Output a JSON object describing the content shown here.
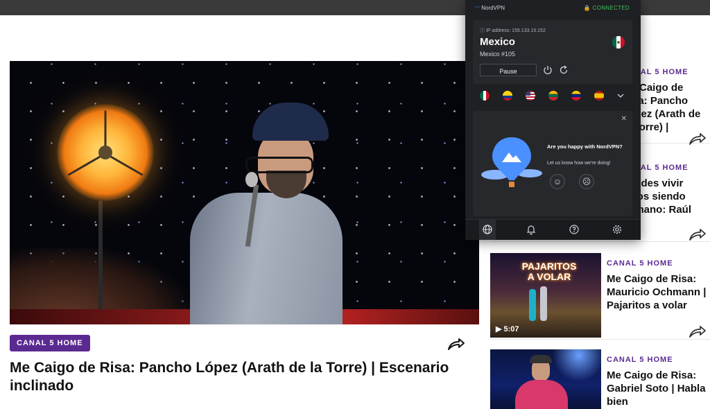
{
  "main": {
    "category": "CANAL 5 HOME",
    "title": "Me Caigo de Risa: Pancho López (Arath de la Torre) | Escenario inclinado"
  },
  "sidebar": {
    "items": [
      {
        "category": "CANAL 5 HOME",
        "title": "Me Caigo de Risa: Pancho López (Arath de la Torre) | Escenario..."
      },
      {
        "category": "CANAL 5 HOME",
        "title": "Puedes vivir tecos siendo humano: Raúl"
      },
      {
        "category": "CANAL 5 HOME",
        "title": "Me Caigo de Risa: Mauricio Ochmann | Pajaritos a volar",
        "duration": "5:07",
        "thumb_text": "PAJARITOS A VOLAR"
      },
      {
        "category": "CANAL 5 HOME",
        "title": "Me Caigo de Risa: Gabriel Soto | Habla bien"
      }
    ]
  },
  "vpn": {
    "brand": "NordVPN",
    "status": "CONNECTED",
    "ip_label": "IP address: 155.133.15.152",
    "country": "Mexico",
    "server": "Mexico #105",
    "pause_label": "Pause",
    "survey_question": "Are you happy with NordVPN?",
    "survey_sub": "Let us know how we're doing!",
    "flags": [
      "mexico",
      "colombia",
      "united-states",
      "lithuania",
      "venezuela",
      "spain"
    ],
    "accent_color": "#3fbf5a"
  },
  "colors": {
    "tag_bg": "#5b2a91",
    "category_text": "#5b2a91"
  }
}
